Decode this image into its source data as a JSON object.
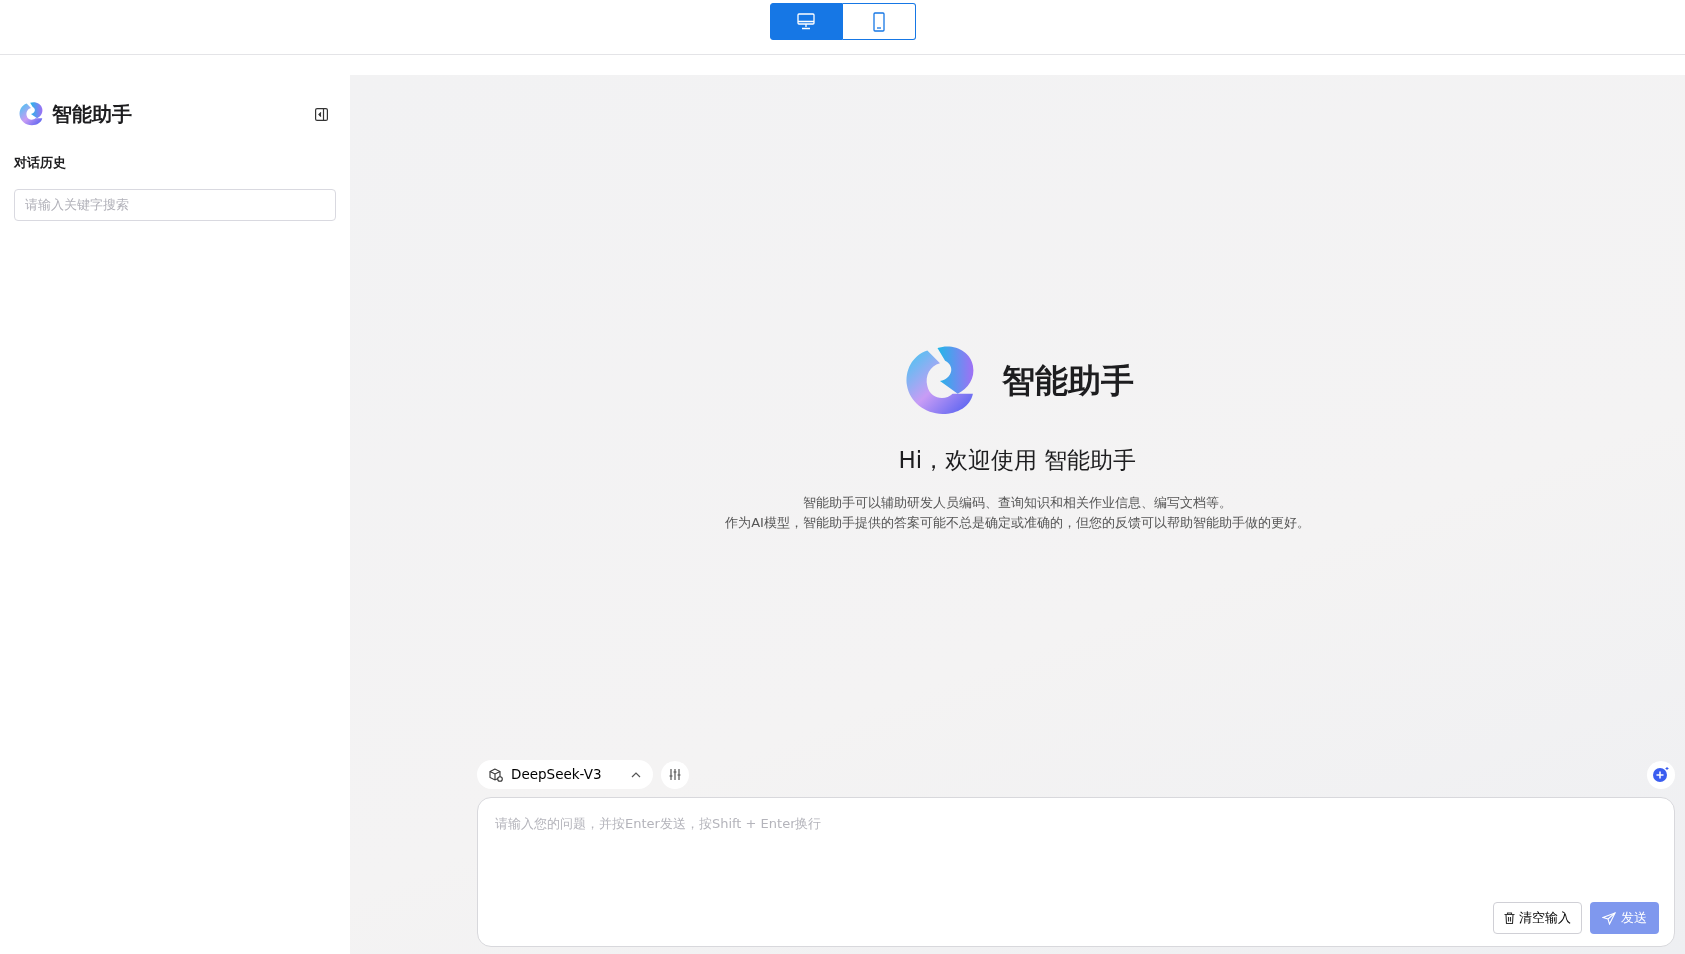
{
  "view_toggle": [
    {
      "kind": "desktop",
      "selected": true
    },
    {
      "kind": "mobile",
      "selected": false
    }
  ],
  "sidebar": {
    "title": "智能助手",
    "section_title": "对话历史",
    "search": {
      "placeholder": "请输入关键字搜索"
    }
  },
  "welcome": {
    "brand": "智能助手",
    "greeting": "Hi，欢迎使用 智能助手",
    "lines": [
      "智能助手可以辅助研发人员编码、查询知识和相关作业信息、编写文档等。",
      "作为AI模型，智能助手提供的答案可能不总是确定或准确的，但您的反馈可以帮助智能助手做的更好。"
    ]
  },
  "composer": {
    "model": "DeepSeek-V3",
    "placeholder": "请输入您的问题，并按Enter发送，按Shift + Enter换行",
    "clear_button": "清空输入",
    "send_button": {
      "label": "发送",
      "disabled": true
    }
  }
}
